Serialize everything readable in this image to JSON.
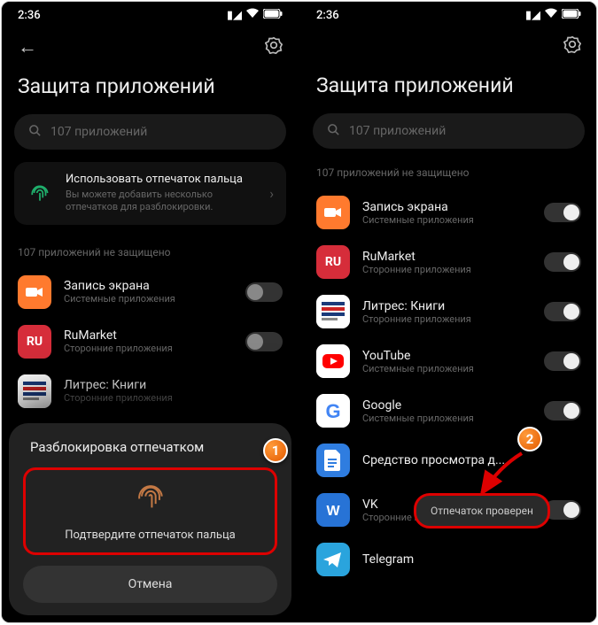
{
  "status": {
    "time": "2:36"
  },
  "header": {
    "title": "Защита приложений"
  },
  "search": {
    "placeholder": "107 приложений"
  },
  "fp_card": {
    "title": "Использовать отпечаток пальца",
    "subtitle": "Вы можете добавить несколько отпечатков для разблокировки."
  },
  "section_label": "107 приложений не защищено",
  "apps_left": [
    {
      "name": "Запись экрана",
      "sub": "Системные приложения"
    },
    {
      "name": "RuMarket",
      "sub": "Сторонние приложения"
    },
    {
      "name": "Литрес: Книги",
      "sub": "Сторонние приложения"
    }
  ],
  "apps_right": [
    {
      "name": "Запись экрана",
      "sub": "Системные приложения"
    },
    {
      "name": "RuMarket",
      "sub": "Сторонние приложения"
    },
    {
      "name": "Литрес: Книги",
      "sub": "Сторонние приложения"
    },
    {
      "name": "YouTube",
      "sub": "Системные приложения"
    },
    {
      "name": "Google",
      "sub": "Системные приложения"
    },
    {
      "name": "Средство просмотра д...",
      "sub": ""
    },
    {
      "name": "VK",
      "sub": "Сторонние приложения"
    },
    {
      "name": "Telegram",
      "sub": ""
    }
  ],
  "dialog": {
    "title": "Разблокировка отпечатком",
    "confirm": "Подтвердите отпечаток пальца",
    "cancel": "Отмена"
  },
  "toast": {
    "text": "Отпечаток проверен"
  },
  "badges": {
    "one": "1",
    "two": "2"
  }
}
